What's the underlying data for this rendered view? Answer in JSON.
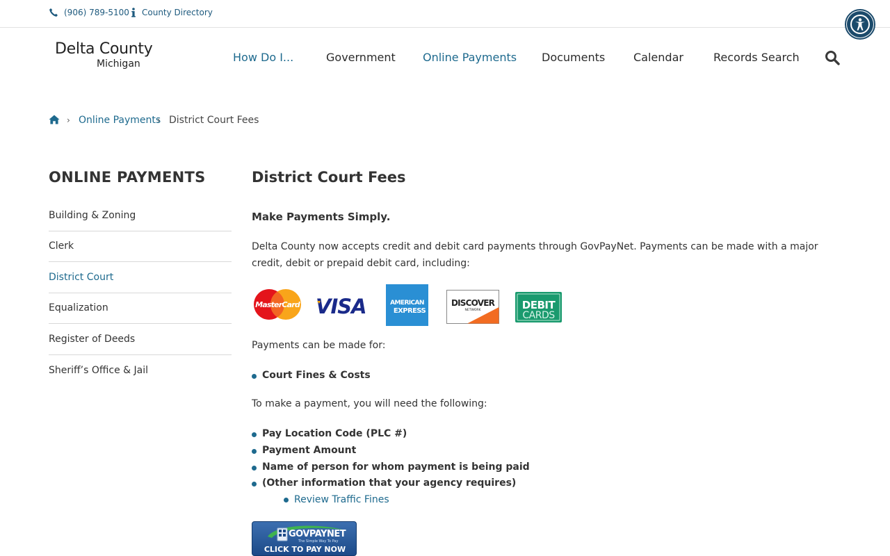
{
  "topbar": {
    "phone": "(906) 789-5100",
    "directory": "County Directory"
  },
  "logo": {
    "line1": "Delta County",
    "line2": "Michigan"
  },
  "nav": {
    "items": [
      {
        "label": "How Do I..."
      },
      {
        "label": "Government"
      },
      {
        "label": "Online Payments"
      },
      {
        "label": "Documents"
      },
      {
        "label": "Calendar"
      },
      {
        "label": "Records Search"
      }
    ]
  },
  "breadcrumb": {
    "parent": "Online Payments",
    "current": "District Court Fees"
  },
  "sidebar": {
    "title": "ONLINE PAYMENTS",
    "items": [
      {
        "label": "Building & Zoning"
      },
      {
        "label": "Clerk"
      },
      {
        "label": "District Court"
      },
      {
        "label": "Equalization"
      },
      {
        "label": "Register of Deeds"
      },
      {
        "label": "Sheriff’s Office & Jail"
      }
    ]
  },
  "main": {
    "title": "District Court Fees",
    "lead": "Make Payments Simply.",
    "intro": "Delta County now accepts credit and debit card payments through GovPayNet. Payments can be made with a major credit, debit or prepaid debit card, including:",
    "cards": {
      "mastercard": "MasterCard",
      "visa": "VISA",
      "amex_1": "AMERICAN",
      "amex_2": "EXPRESS",
      "discover": "DISCOVER",
      "discover_sub": "NETWORK",
      "debit_1": "DEBIT",
      "debit_2": "CARDS"
    },
    "payments_for_label": "Payments can be made for:",
    "payments_for": [
      "Court Fines & Costs"
    ],
    "need_label": "To make a payment, you will need the following:",
    "needs": [
      "Pay Location Code (PLC #)",
      "Payment Amount",
      "Name of person for whom payment is being paid",
      "(Other information that your agency requires)"
    ],
    "sub_link": "Review Traffic Fines",
    "paynow": {
      "brand": "GOVPAYNET",
      "tag": "The Simple Way To Pay",
      "cta": "CLICK TO PAY NOW"
    }
  },
  "colors": {
    "accent": "#1e6a8e",
    "text": "#333333",
    "a11y": "#1b4a6b"
  }
}
